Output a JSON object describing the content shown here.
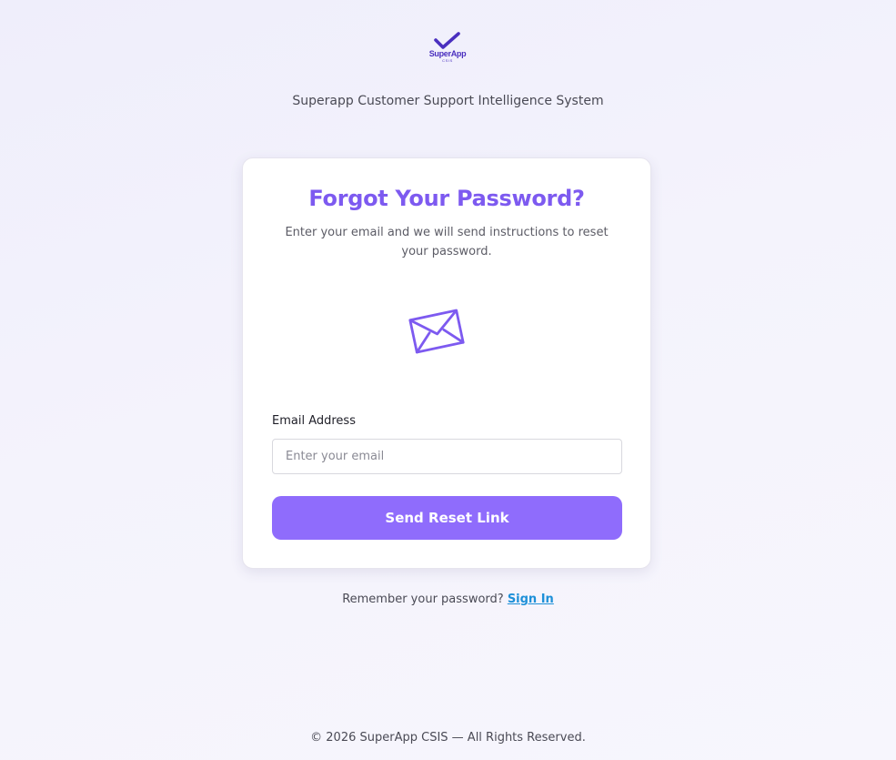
{
  "brand": {
    "logo_name": "SuperApp",
    "logo_sub": "CSIS",
    "accent_color": "#7d5af0",
    "logo_color": "#4a2fbf",
    "logo_icon": "checkmark-icon"
  },
  "header": {
    "subtitle": "Superapp Customer Support Intelligence System"
  },
  "card": {
    "title": "Forgot Your Password?",
    "description": "Enter your email and we will send instructions to reset your password.",
    "illustration_icon": "envelope-icon"
  },
  "form": {
    "email_label": "Email Address",
    "email_value": "",
    "email_placeholder": "Enter your email",
    "submit_label": "Send Reset Link",
    "button_color": "#8f6cfc"
  },
  "signin": {
    "prompt": "Remember your password?",
    "link_label": "Sign In",
    "link_color": "#1e90d8"
  },
  "footer": {
    "copyright": "© 2026 SuperApp CSIS — All Rights Reserved."
  }
}
